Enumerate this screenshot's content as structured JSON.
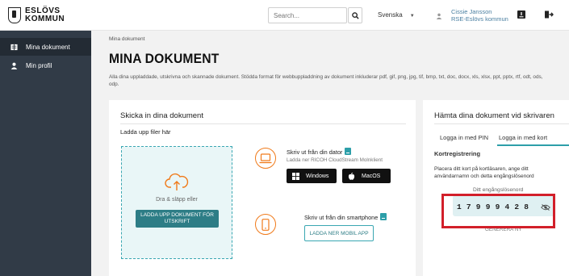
{
  "brand": {
    "line1": "ESLÖVS",
    "line2": "KOMMUN"
  },
  "header": {
    "search_placeholder": "Search...",
    "language": "Svenska",
    "user_name": "Cissie Jansson",
    "user_org": "RSE-Eslövs kommun"
  },
  "sidebar": {
    "items": [
      {
        "label": "Mina dokument",
        "active": true
      },
      {
        "label": "Min profil",
        "active": false
      }
    ]
  },
  "main": {
    "breadcrumb": "Mina dokument",
    "title": "MINA DOKUMENT",
    "description": "Alla dina uppladdade, utskrivna och skannade dokument. Stödda format för webbuppladdning av dokument inkluderar pdf, gif, png, jpg, tif, bmp, txt, doc, docx, xls, xlsx, ppt, pptx, rtf, odt, ods, odp."
  },
  "upload_card": {
    "title": "Skicka in dina dokument",
    "subtitle": "Ladda upp filer här",
    "drop_text": "Dra & släpp eller",
    "upload_button": "LADDA UPP DOKUMENT FÖR UTSKRIFT",
    "computer": {
      "title": "Skriv ut från din dator",
      "subtitle": "Ladda ner RICOH CloudStream Molnklient",
      "windows_label": "Windows",
      "mac_label": "MacOS"
    },
    "phone": {
      "title": "Skriv ut från din smartphone",
      "app_button": "LADDA NER MOBIL APP"
    }
  },
  "printer_card": {
    "title": "Hämta dina dokument vid skrivaren",
    "tabs": [
      "Logga in med PIN",
      "Logga in med kort"
    ],
    "active_tab": 1,
    "heading": "Kortregistrering",
    "instructions": "Placera ditt kort på kortläsaren, ange ditt användarnamn och detta engångslösenord",
    "pin_label": "Ditt engångslösenord",
    "pin_code": "17999428",
    "generate_label": "GENERERA NY"
  },
  "colors": {
    "sidebar": "#313b47",
    "accent": "#2d9fa9",
    "button": "#2d7d86",
    "icon_orange": "#f07a1a",
    "highlight": "#d21f2a"
  }
}
